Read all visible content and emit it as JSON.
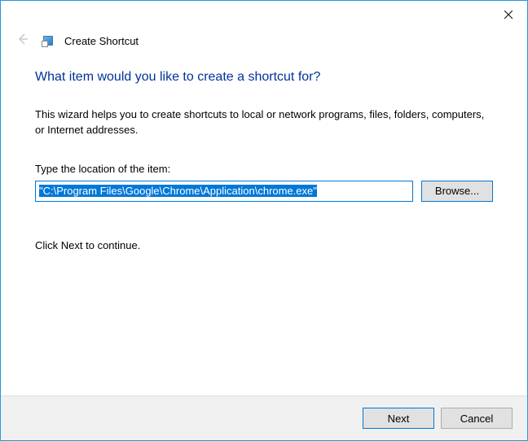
{
  "header": {
    "title": "Create Shortcut"
  },
  "content": {
    "main_heading": "What item would you like to create a shortcut for?",
    "description": "This wizard helps you to create shortcuts to local or network programs, files, folders, computers, or Internet addresses.",
    "field_label": "Type the location of the item:",
    "path_value": "\"C:\\Program Files\\Google\\Chrome\\Application\\chrome.exe\"",
    "browse_label": "Browse...",
    "continue_text": "Click Next to continue."
  },
  "footer": {
    "next_label": "Next",
    "cancel_label": "Cancel"
  }
}
